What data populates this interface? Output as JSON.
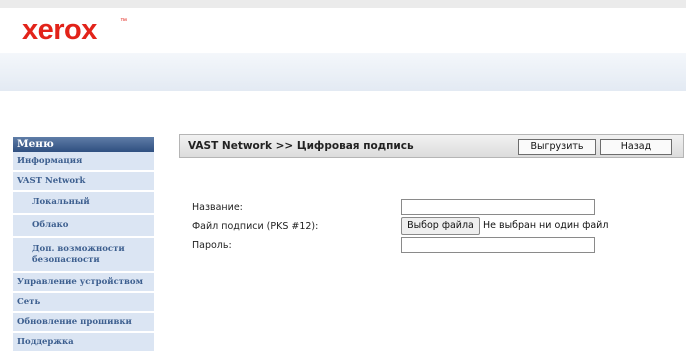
{
  "brand": {
    "logo_text": "xerox",
    "tm": "™",
    "logo_color": "#e2231a"
  },
  "sidebar": {
    "header": "Меню",
    "items": [
      {
        "label": "Информация"
      },
      {
        "label": "VAST Network"
      },
      {
        "label": "Локальный"
      },
      {
        "label": "Облако"
      },
      {
        "label": "Доп. возможности безопасности"
      },
      {
        "label": "Управление устройством"
      },
      {
        "label": "Сеть"
      },
      {
        "label": "Обновление прошивки"
      },
      {
        "label": "Поддержка"
      }
    ]
  },
  "titlebar": {
    "title": "VAST Network >> Цифровая подпись",
    "upload_label": "Выгрузить",
    "back_label": "Назад"
  },
  "form": {
    "name_label": "Название:",
    "name_value": "",
    "signature_file_label": "Файл подписи (PKS #12):",
    "choose_file_label": "Выбор файла",
    "no_file_text": "Не выбран ни один файл",
    "password_label": "Пароль:",
    "password_value": ""
  },
  "colors": {
    "menu_header": "#2f4f80",
    "menu_item_bg": "#dbe5f3",
    "menu_item_text": "#3d5f8f"
  }
}
